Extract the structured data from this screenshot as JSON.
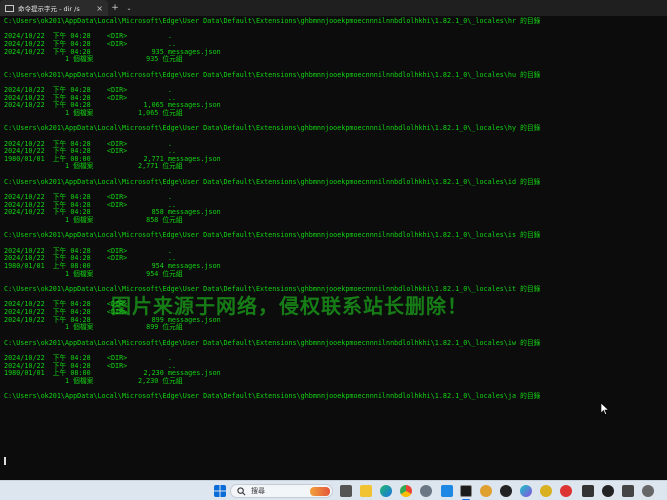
{
  "window": {
    "tab_title": "命令提示字元 - dir /s",
    "new_tab_label": "+",
    "dropdown_label": "⌄",
    "close_label": "×"
  },
  "terminal": {
    "lines": [
      "C:\\Users\\ok201\\AppData\\Local\\Microsoft\\Edge\\User Data\\Default\\Extensions\\ghbmnnjooekpmoecnnnilnnbdlolhkhi\\1.82.1_0\\_locales\\hr 的目錄",
      "",
      "2024/10/22  下午 04:28    <DIR>          .",
      "2024/10/22  下午 04:28    <DIR>          ..",
      "2024/10/22  下午 04:28               935 messages.json",
      "               1 個檔案             935 位元組",
      "",
      "C:\\Users\\ok201\\AppData\\Local\\Microsoft\\Edge\\User Data\\Default\\Extensions\\ghbmnnjooekpmoecnnnilnnbdlolhkhi\\1.82.1_0\\_locales\\hu 的目錄",
      "",
      "2024/10/22  下午 04:28    <DIR>          .",
      "2024/10/22  下午 04:28    <DIR>          ..",
      "2024/10/22  下午 04:28             1,065 messages.json",
      "               1 個檔案           1,065 位元組",
      "",
      "C:\\Users\\ok201\\AppData\\Local\\Microsoft\\Edge\\User Data\\Default\\Extensions\\ghbmnnjooekpmoecnnnilnnbdlolhkhi\\1.82.1_0\\_locales\\hy 的目錄",
      "",
      "2024/10/22  下午 04:28    <DIR>          .",
      "2024/10/22  下午 04:28    <DIR>          ..",
      "1980/01/01  上午 08:00             2,771 messages.json",
      "               1 個檔案           2,771 位元組",
      "",
      "C:\\Users\\ok201\\AppData\\Local\\Microsoft\\Edge\\User Data\\Default\\Extensions\\ghbmnnjooekpmoecnnnilnnbdlolhkhi\\1.82.1_0\\_locales\\id 的目錄",
      "",
      "2024/10/22  下午 04:28    <DIR>          .",
      "2024/10/22  下午 04:28    <DIR>          ..",
      "2024/10/22  下午 04:28               858 messages.json",
      "               1 個檔案             858 位元組",
      "",
      "C:\\Users\\ok201\\AppData\\Local\\Microsoft\\Edge\\User Data\\Default\\Extensions\\ghbmnnjooekpmoecnnnilnnbdlolhkhi\\1.82.1_0\\_locales\\is 的目錄",
      "",
      "2024/10/22  下午 04:28    <DIR>          .",
      "2024/10/22  下午 04:28    <DIR>          ..",
      "1980/01/01  上午 08:00               954 messages.json",
      "               1 個檔案             954 位元組",
      "",
      "C:\\Users\\ok201\\AppData\\Local\\Microsoft\\Edge\\User Data\\Default\\Extensions\\ghbmnnjooekpmoecnnnilnnbdlolhkhi\\1.82.1_0\\_locales\\it 的目錄",
      "",
      "2024/10/22  下午 04:28    <DIR>          .",
      "2024/10/22  下午 04:28    <DIR>          ..",
      "2024/10/22  下午 04:28               899 messages.json",
      "               1 個檔案             899 位元組",
      "",
      "C:\\Users\\ok201\\AppData\\Local\\Microsoft\\Edge\\User Data\\Default\\Extensions\\ghbmnnjooekpmoecnnnilnnbdlolhkhi\\1.82.1_0\\_locales\\iw 的目錄",
      "",
      "2024/10/22  下午 04:28    <DIR>          .",
      "2024/10/22  下午 04:28    <DIR>          ..",
      "1980/01/01  上午 08:00             2,230 messages.json",
      "               1 個檔案           2,230 位元組",
      "",
      "C:\\Users\\ok201\\AppData\\Local\\Microsoft\\Edge\\User Data\\Default\\Extensions\\ghbmnnjooekpmoecnnnilnnbdlolhkhi\\1.82.1_0\\_locales\\ja 的目錄"
    ]
  },
  "watermark": {
    "text": "图片来源于网络，侵权联系站长删除！"
  },
  "taskbar": {
    "search_placeholder": "搜尋",
    "icons": [
      "windows-start-icon",
      "search-icon",
      "task-view-icon",
      "file-explorer-icon",
      "edge-icon",
      "chrome-icon",
      "settings-icon",
      "vscode-icon",
      "terminal-icon",
      "game-icon",
      "media-icon",
      "copilot-icon",
      "camera-icon",
      "app-icon",
      "app-icon-2",
      "app-icon-3"
    ]
  },
  "colors": {
    "terminal_text": "#13d413",
    "terminal_bg": "#0c0c0c",
    "taskbar_bg": "#dde5ee",
    "watermark": "#1ec81e"
  }
}
